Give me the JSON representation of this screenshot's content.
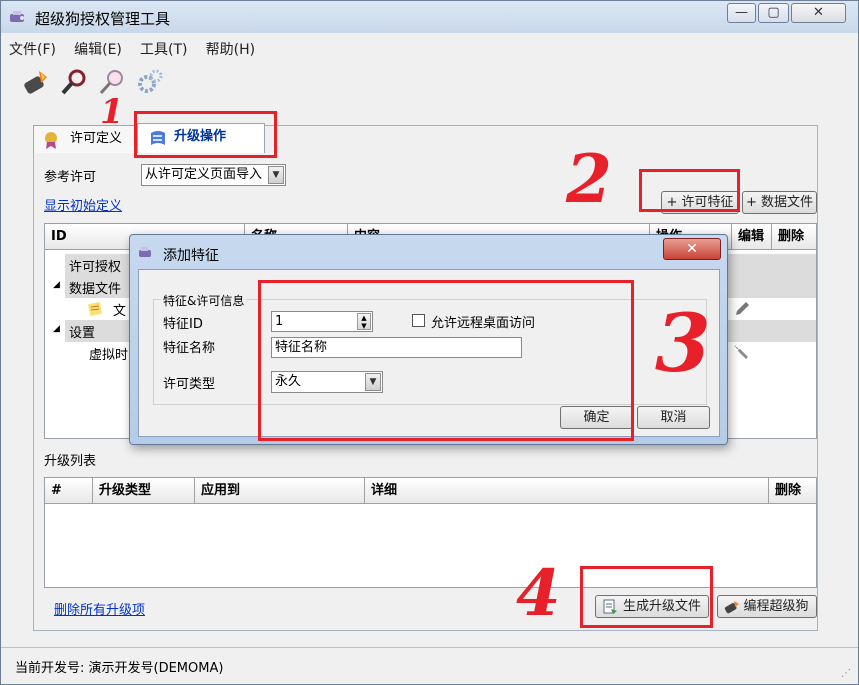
{
  "window": {
    "title": "超级狗授权管理工具",
    "controls": [
      "—",
      "▢",
      "✕"
    ]
  },
  "menu": [
    "文件(F)",
    "编辑(E)",
    "工具(T)",
    "帮助(H)"
  ],
  "tabs": [
    "许可定义",
    "升级操作"
  ],
  "reference": {
    "label": "参考许可",
    "combo_value": "从许可定义页面导入",
    "show_initial_link": "显示初始定义"
  },
  "buttons": {
    "add_feature": "+ 许可特征",
    "add_data_file": "+ 数据文件",
    "delete_all_link": "删除所有升级项",
    "generate": "生成升级文件",
    "program": "编程超级狗"
  },
  "def_table": {
    "columns": [
      "ID",
      "名称",
      "内容",
      "操作",
      "编辑",
      "删除"
    ],
    "tree": [
      {
        "text": "许可授权"
      },
      {
        "text": "数据文件"
      },
      {
        "text": "文"
      },
      {
        "text": "设置"
      },
      {
        "text": "虚拟时"
      }
    ]
  },
  "upgrade_list": {
    "label": "升级列表",
    "columns": [
      "#",
      "升级类型",
      "应用到",
      "详细",
      "删除"
    ]
  },
  "status": {
    "text": "当前开发号: 演示开发号(DEMOMA)"
  },
  "dialog": {
    "title": "添加特征",
    "group_label": "特征&许可信息",
    "feature_id_label": "特征ID",
    "feature_id_value": "1",
    "remote_desktop_label": "允许远程桌面访问",
    "feature_name_label": "特征名称",
    "feature_name_value": "特征名称",
    "license_type_label": "许可类型",
    "license_type_value": "永久",
    "ok": "确定",
    "cancel": "取消"
  },
  "annotations": [
    "1",
    "2",
    "3",
    "4"
  ],
  "colors": {
    "annotation_red": "#e8202a",
    "link_blue": "#0033cc",
    "active_tab_text": "#003399"
  }
}
